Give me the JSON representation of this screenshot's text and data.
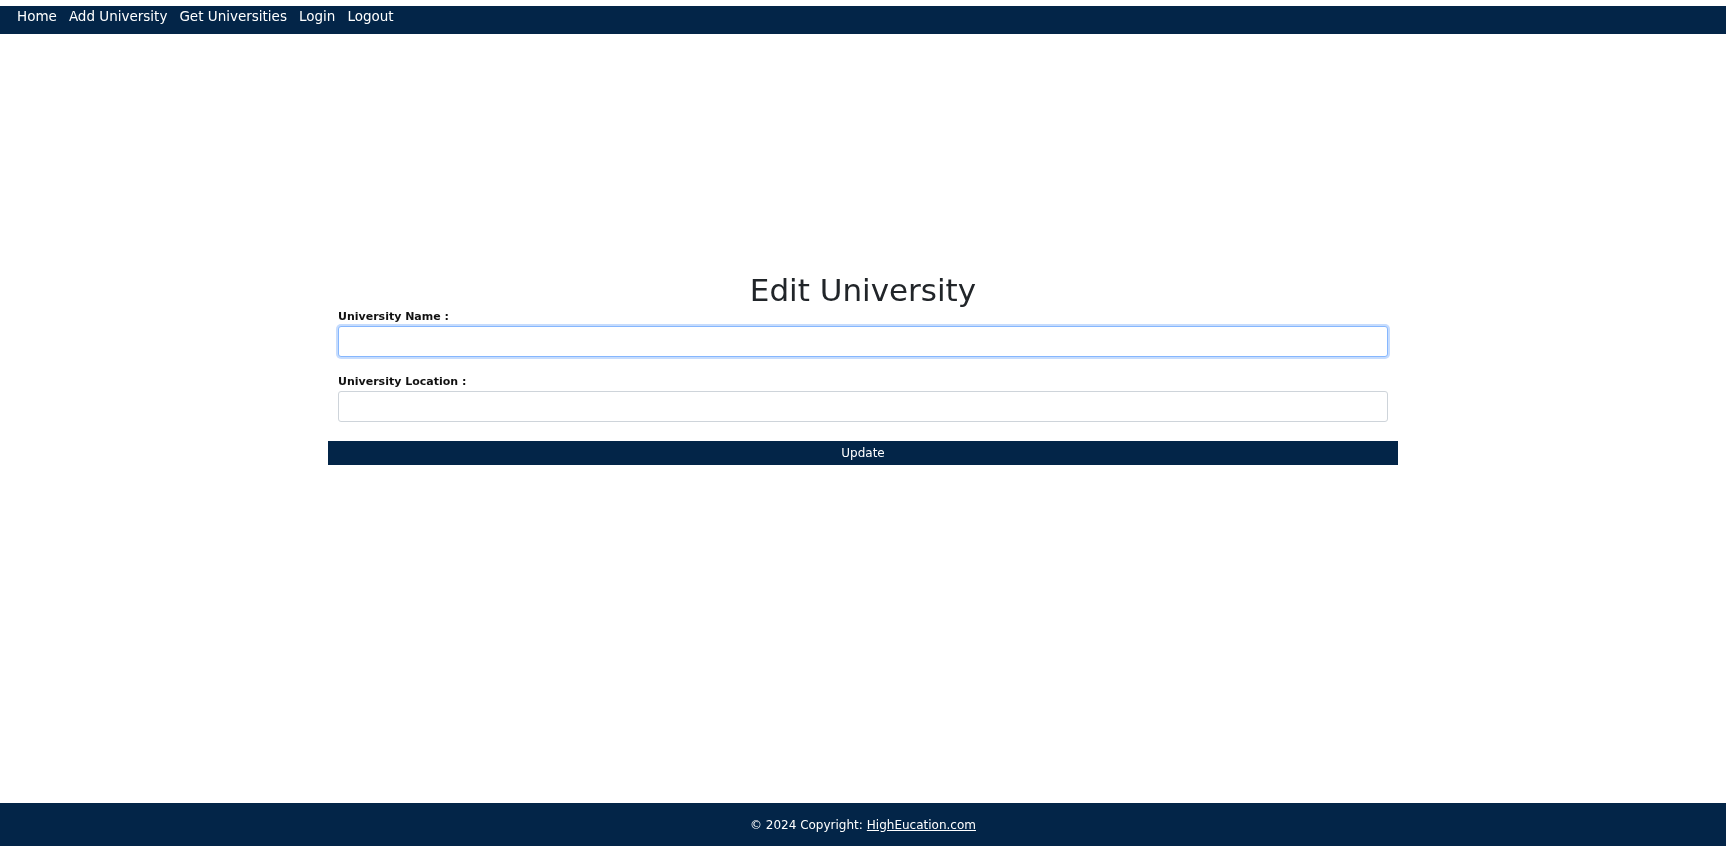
{
  "nav": {
    "links": [
      {
        "label": "Home"
      },
      {
        "label": "Add University"
      },
      {
        "label": "Get Universities"
      },
      {
        "label": "Login"
      },
      {
        "label": "Logout"
      }
    ]
  },
  "form": {
    "title": "Edit University",
    "fields": [
      {
        "label": "University Name :",
        "focused": true
      },
      {
        "label": "University Location :",
        "focused": false
      }
    ],
    "button": "Update"
  },
  "footer": {
    "text": "© 2024 Copyright:",
    "link": "HighEucation.com"
  }
}
